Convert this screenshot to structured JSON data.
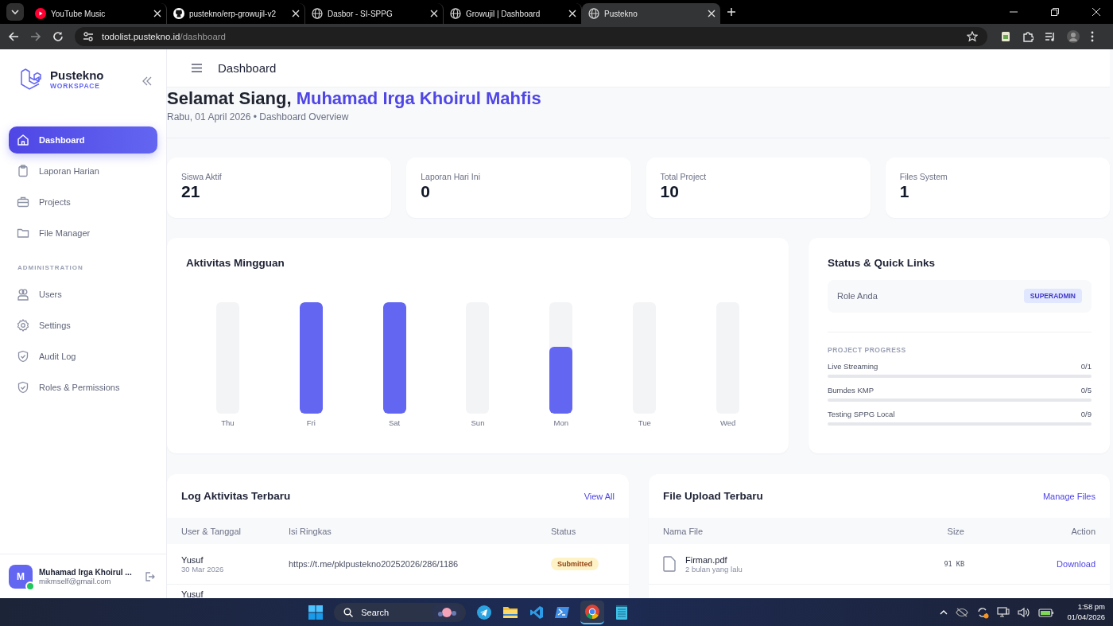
{
  "browser": {
    "tabs": [
      {
        "title": "YouTube Music",
        "kind": "youtube",
        "selected": false
      },
      {
        "title": "pustekno/erp-growujil-v2",
        "kind": "github",
        "selected": false
      },
      {
        "title": "Dasbor - SI-SPPG",
        "kind": "globe",
        "selected": false
      },
      {
        "title": "Growujil | Dashboard",
        "kind": "globe",
        "selected": false
      },
      {
        "title": "Pustekno",
        "kind": "globe",
        "selected": true
      }
    ],
    "url": {
      "host": "todolist.pustekno.id",
      "path": "/dashboard"
    }
  },
  "sidebar": {
    "brand": "Pustekno",
    "brand_sub": "WORKSPACE",
    "items": [
      {
        "label": "Dashboard",
        "kind": "home",
        "selected": true
      },
      {
        "label": "Laporan Harian",
        "kind": "clipboard",
        "selected": false
      },
      {
        "label": "Projects",
        "kind": "briefcase",
        "selected": false
      },
      {
        "label": "File Manager",
        "kind": "folder",
        "selected": false
      }
    ],
    "section": "ADMINISTRATION",
    "admin_items": [
      {
        "label": "Users",
        "kind": "users",
        "selected": false
      },
      {
        "label": "Settings",
        "kind": "gear",
        "selected": false
      },
      {
        "label": "Audit Log",
        "kind": "shield",
        "selected": false
      },
      {
        "label": "Roles & Permissions",
        "kind": "shield",
        "selected": false
      }
    ],
    "user": {
      "initial": "M",
      "name": "Muhamad Irga Khoirul ...",
      "email": "mikmself@gmail.com",
      "online": true
    }
  },
  "header": {
    "title": "Dashboard"
  },
  "greeting": {
    "text": "Selamat Siang,",
    "name": "Muhamad Irga Khoirul Mahfis",
    "subtitle": "Rabu, 01 April 2026 • Dashboard Overview"
  },
  "stats": [
    {
      "label": "Siswa Aktif",
      "value": "21"
    },
    {
      "label": "Laporan Hari Ini",
      "value": "0"
    },
    {
      "label": "Total Project",
      "value": "10"
    },
    {
      "label": "Files System",
      "value": "1"
    }
  ],
  "weekly": {
    "title": "Aktivitas Mingguan",
    "days": [
      {
        "label": "Thu",
        "level": 0
      },
      {
        "label": "Fri",
        "level": 1
      },
      {
        "label": "Sat",
        "level": 1
      },
      {
        "label": "Sun",
        "level": 0
      },
      {
        "label": "Mon",
        "level": 0.6
      },
      {
        "label": "Tue",
        "level": 0
      },
      {
        "label": "Wed",
        "level": 0
      }
    ]
  },
  "status": {
    "title": "Status & Quick Links",
    "role_label": "Role Anda",
    "role": "SUPERADMIN",
    "progress_title": "PROJECT PROGRESS",
    "projects": [
      {
        "name": "Live Streaming",
        "count": "0/1",
        "level": 0
      },
      {
        "name": "Bumdes KMP",
        "count": "0/5",
        "level": 0
      },
      {
        "name": "Testing SPPG Local",
        "count": "0/9",
        "level": 0
      }
    ]
  },
  "log": {
    "title": "Log Aktivitas Terbaru",
    "link": "View All",
    "columns": [
      "User & Tanggal",
      "Isi Ringkas",
      "Status"
    ],
    "rows": [
      {
        "user": "Yusuf",
        "date": "30 Mar 2026",
        "summary": "https://t.me/pklpustekno20252026/286/1186",
        "status": "Submitted"
      },
      {
        "user": "Yusuf"
      }
    ]
  },
  "files": {
    "title": "File Upload Terbaru",
    "link": "Manage Files",
    "columns": [
      "Nama File",
      "Size",
      "Action"
    ],
    "rows": [
      {
        "name": "Firman.pdf",
        "time": "2 bulan yang lalu",
        "size": "91 KB",
        "action": "Download"
      }
    ]
  },
  "taskbar": {
    "search": "Search",
    "time": "1:58 pm",
    "date": "01/04/2026"
  }
}
